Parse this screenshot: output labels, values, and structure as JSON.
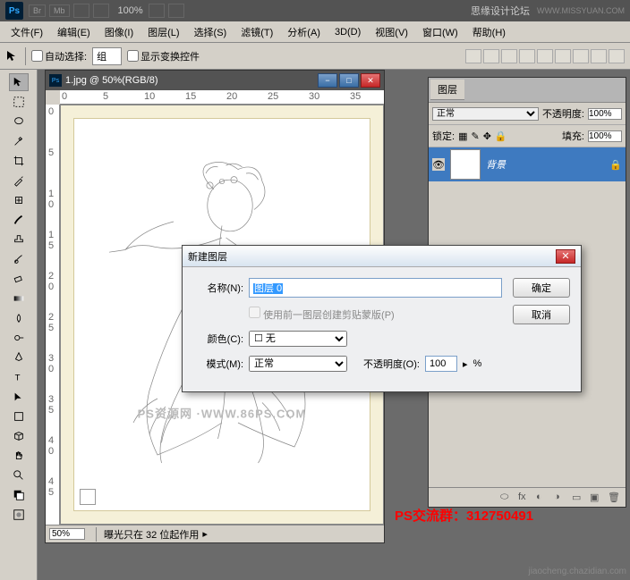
{
  "topbar": {
    "br": "Br",
    "mb": "Mb",
    "zoom": "100%",
    "forum": "思缘设计论坛",
    "url": "WWW.MISSYUAN.COM"
  },
  "menu": [
    "文件(F)",
    "编辑(E)",
    "图像(I)",
    "图层(L)",
    "选择(S)",
    "滤镜(T)",
    "分析(A)",
    "3D(D)",
    "视图(V)",
    "窗口(W)",
    "帮助(H)"
  ],
  "optbar": {
    "autoSelect": "自动选择:",
    "group": "组",
    "showTransform": "显示变换控件"
  },
  "doc": {
    "title": "1.jpg @ 50%(RGB/8)",
    "watermark": "PS资源网 ·WWW.86PS.COM",
    "zoom": "50%",
    "status": "曝光只在 32 位起作用"
  },
  "rulerH": [
    "0",
    "5",
    "10",
    "15",
    "20",
    "25",
    "30",
    "35"
  ],
  "rulerV": [
    "0",
    "5",
    "1 0",
    "1 5",
    "2 0",
    "2 5",
    "3 0",
    "3 5",
    "4 0",
    "4 5"
  ],
  "panel": {
    "tab": "图层",
    "blend": "正常",
    "opacityLabel": "不透明度:",
    "opacity": "100%",
    "lockLabel": "锁定:",
    "fillLabel": "填充:",
    "fill": "100%",
    "layerName": "背景"
  },
  "dialog": {
    "title": "新建图层",
    "nameLabel": "名称(N):",
    "nameValue": "图层 0",
    "clip": "使用前一图层创建剪贴蒙版(P)",
    "colorLabel": "颜色(C):",
    "colorValue": "无",
    "modeLabel": "模式(M):",
    "modeValue": "正常",
    "opLabel": "不透明度(O):",
    "opValue": "100",
    "opUnit": "%",
    "ok": "确定",
    "cancel": "取消"
  },
  "annot": "PS交流群：312750491",
  "credit": "jiaocheng.chazidian.com"
}
